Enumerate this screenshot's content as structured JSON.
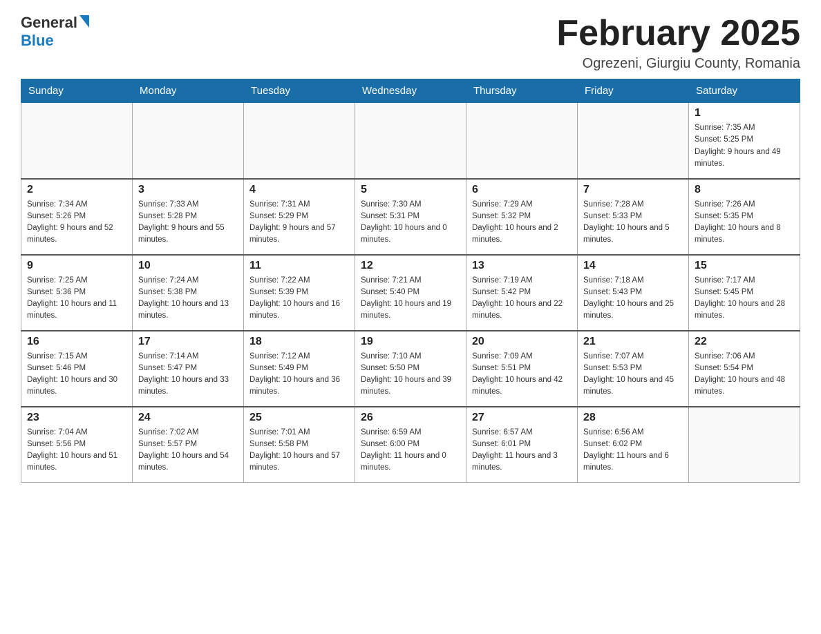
{
  "header": {
    "logo_general": "General",
    "logo_blue": "Blue",
    "month_title": "February 2025",
    "location": "Ogrezeni, Giurgiu County, Romania"
  },
  "days_of_week": [
    "Sunday",
    "Monday",
    "Tuesday",
    "Wednesday",
    "Thursday",
    "Friday",
    "Saturday"
  ],
  "weeks": [
    [
      {
        "day": "",
        "info": ""
      },
      {
        "day": "",
        "info": ""
      },
      {
        "day": "",
        "info": ""
      },
      {
        "day": "",
        "info": ""
      },
      {
        "day": "",
        "info": ""
      },
      {
        "day": "",
        "info": ""
      },
      {
        "day": "1",
        "info": "Sunrise: 7:35 AM\nSunset: 5:25 PM\nDaylight: 9 hours and 49 minutes."
      }
    ],
    [
      {
        "day": "2",
        "info": "Sunrise: 7:34 AM\nSunset: 5:26 PM\nDaylight: 9 hours and 52 minutes."
      },
      {
        "day": "3",
        "info": "Sunrise: 7:33 AM\nSunset: 5:28 PM\nDaylight: 9 hours and 55 minutes."
      },
      {
        "day": "4",
        "info": "Sunrise: 7:31 AM\nSunset: 5:29 PM\nDaylight: 9 hours and 57 minutes."
      },
      {
        "day": "5",
        "info": "Sunrise: 7:30 AM\nSunset: 5:31 PM\nDaylight: 10 hours and 0 minutes."
      },
      {
        "day": "6",
        "info": "Sunrise: 7:29 AM\nSunset: 5:32 PM\nDaylight: 10 hours and 2 minutes."
      },
      {
        "day": "7",
        "info": "Sunrise: 7:28 AM\nSunset: 5:33 PM\nDaylight: 10 hours and 5 minutes."
      },
      {
        "day": "8",
        "info": "Sunrise: 7:26 AM\nSunset: 5:35 PM\nDaylight: 10 hours and 8 minutes."
      }
    ],
    [
      {
        "day": "9",
        "info": "Sunrise: 7:25 AM\nSunset: 5:36 PM\nDaylight: 10 hours and 11 minutes."
      },
      {
        "day": "10",
        "info": "Sunrise: 7:24 AM\nSunset: 5:38 PM\nDaylight: 10 hours and 13 minutes."
      },
      {
        "day": "11",
        "info": "Sunrise: 7:22 AM\nSunset: 5:39 PM\nDaylight: 10 hours and 16 minutes."
      },
      {
        "day": "12",
        "info": "Sunrise: 7:21 AM\nSunset: 5:40 PM\nDaylight: 10 hours and 19 minutes."
      },
      {
        "day": "13",
        "info": "Sunrise: 7:19 AM\nSunset: 5:42 PM\nDaylight: 10 hours and 22 minutes."
      },
      {
        "day": "14",
        "info": "Sunrise: 7:18 AM\nSunset: 5:43 PM\nDaylight: 10 hours and 25 minutes."
      },
      {
        "day": "15",
        "info": "Sunrise: 7:17 AM\nSunset: 5:45 PM\nDaylight: 10 hours and 28 minutes."
      }
    ],
    [
      {
        "day": "16",
        "info": "Sunrise: 7:15 AM\nSunset: 5:46 PM\nDaylight: 10 hours and 30 minutes."
      },
      {
        "day": "17",
        "info": "Sunrise: 7:14 AM\nSunset: 5:47 PM\nDaylight: 10 hours and 33 minutes."
      },
      {
        "day": "18",
        "info": "Sunrise: 7:12 AM\nSunset: 5:49 PM\nDaylight: 10 hours and 36 minutes."
      },
      {
        "day": "19",
        "info": "Sunrise: 7:10 AM\nSunset: 5:50 PM\nDaylight: 10 hours and 39 minutes."
      },
      {
        "day": "20",
        "info": "Sunrise: 7:09 AM\nSunset: 5:51 PM\nDaylight: 10 hours and 42 minutes."
      },
      {
        "day": "21",
        "info": "Sunrise: 7:07 AM\nSunset: 5:53 PM\nDaylight: 10 hours and 45 minutes."
      },
      {
        "day": "22",
        "info": "Sunrise: 7:06 AM\nSunset: 5:54 PM\nDaylight: 10 hours and 48 minutes."
      }
    ],
    [
      {
        "day": "23",
        "info": "Sunrise: 7:04 AM\nSunset: 5:56 PM\nDaylight: 10 hours and 51 minutes."
      },
      {
        "day": "24",
        "info": "Sunrise: 7:02 AM\nSunset: 5:57 PM\nDaylight: 10 hours and 54 minutes."
      },
      {
        "day": "25",
        "info": "Sunrise: 7:01 AM\nSunset: 5:58 PM\nDaylight: 10 hours and 57 minutes."
      },
      {
        "day": "26",
        "info": "Sunrise: 6:59 AM\nSunset: 6:00 PM\nDaylight: 11 hours and 0 minutes."
      },
      {
        "day": "27",
        "info": "Sunrise: 6:57 AM\nSunset: 6:01 PM\nDaylight: 11 hours and 3 minutes."
      },
      {
        "day": "28",
        "info": "Sunrise: 6:56 AM\nSunset: 6:02 PM\nDaylight: 11 hours and 6 minutes."
      },
      {
        "day": "",
        "info": ""
      }
    ]
  ]
}
